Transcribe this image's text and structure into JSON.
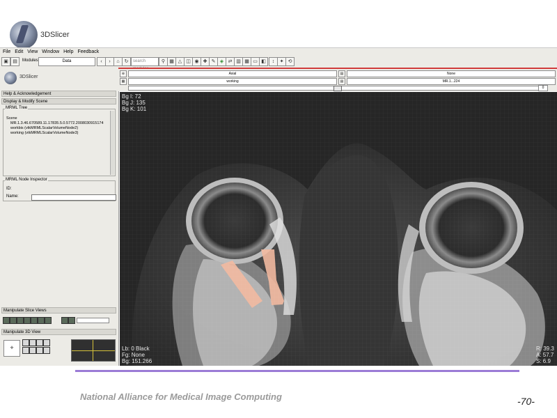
{
  "slide_header": {
    "logo_text": "3DSlicer"
  },
  "menubar": [
    "File",
    "Edit",
    "View",
    "Window",
    "Help",
    "Feedback"
  ],
  "toolbar": {
    "modules_label": "Modules",
    "module_select": "Data",
    "search_placeholder": "search modules"
  },
  "left_panel": {
    "module_logo_text": "3DSlicer",
    "sections": {
      "help": "Help & Acknowledgement",
      "display": "Display & Modify Scene",
      "slice_views": "Manipulate Slice Views",
      "view3d": "Manipulate 3D View"
    },
    "mrml_tree": {
      "title": "MRML Tree",
      "items": [
        "Scene",
        "MR.1.3.46.670589.11.17835.5.0.5772.2008030915174",
        "workbis (vtkMRMLScalarVolumeNode2)",
        "working (vtkMRMLScalarVolumeNode3)"
      ]
    },
    "node_inspector": {
      "title": "MRML Node Inspector",
      "id_label": "ID:",
      "name_label": "Name:"
    }
  },
  "viewer_controls": {
    "sel_top_left": "Axial",
    "sel_top_right": "None",
    "sel_bottom_left": "working",
    "sel_bottom_right": "MR.1...224",
    "slider_value": "0"
  },
  "viewer": {
    "top_left": [
      "Bg I: 72",
      "Bg J: 135",
      "Bg K: 101"
    ],
    "bottom_left": [
      "Lb: 0 Black",
      "Fg: None",
      "Bg: 151.266"
    ],
    "bottom_right": [
      "R: 39.3",
      "A: 57.7",
      "S: 6.9"
    ]
  },
  "footer": {
    "organization": "National Alliance for Medical Image Computing",
    "page": "-70-"
  },
  "colors": {
    "accent_rule": "#9b7bd6",
    "viewer_border": "#d13a3a",
    "segmentation": "#f2b9a0"
  }
}
